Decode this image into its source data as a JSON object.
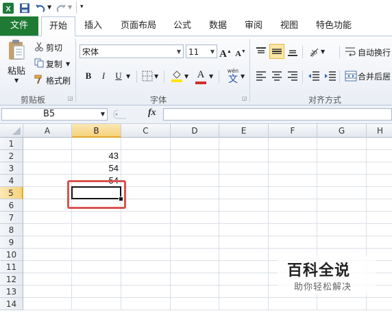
{
  "qat": {
    "excel_icon": "excel-logo-icon",
    "save_icon": "save-icon",
    "undo_icon": "undo-icon",
    "redo_icon": "redo-icon",
    "customize_icon": "customize-qat-icon"
  },
  "tabs": [
    {
      "label": "文件"
    },
    {
      "label": "开始"
    },
    {
      "label": "插入"
    },
    {
      "label": "页面布局"
    },
    {
      "label": "公式"
    },
    {
      "label": "数据"
    },
    {
      "label": "审阅"
    },
    {
      "label": "视图"
    },
    {
      "label": "特色功能"
    }
  ],
  "ribbon": {
    "clipboard": {
      "paste": "粘贴",
      "cut": "剪切",
      "copy": "复制",
      "format_painter": "格式刷",
      "group_label": "剪贴板"
    },
    "font": {
      "font_name": "宋体",
      "font_size": "11",
      "bold": "B",
      "italic": "I",
      "underline": "U",
      "font_color_letter": "A",
      "phonetic": "wén",
      "phonetic_char": "文",
      "group_label": "字体",
      "accent_red": "#d32f2f",
      "accent_yellow": "#ffe600"
    },
    "alignment": {
      "wrap_text": "自动换行",
      "merge_center": "合并后居",
      "group_label": "对齐方式"
    }
  },
  "formula_bar": {
    "name_box": "B5",
    "fx_label": "fx",
    "content": ""
  },
  "grid": {
    "columns": [
      "A",
      "B",
      "C",
      "D",
      "E",
      "F",
      "G",
      "H"
    ],
    "rows": [
      "1",
      "2",
      "3",
      "4",
      "5",
      "6",
      "7",
      "8",
      "9",
      "10",
      "11",
      "12",
      "13",
      "14"
    ],
    "cells": {
      "B2": "43",
      "B3": "54",
      "B4": "54"
    },
    "selected_cell": "B5",
    "selected_column": "B",
    "selected_row": "5",
    "highlight_color": "#d9534f"
  },
  "watermark": {
    "title": "百科全说",
    "subtitle": "助你轻松解决"
  }
}
